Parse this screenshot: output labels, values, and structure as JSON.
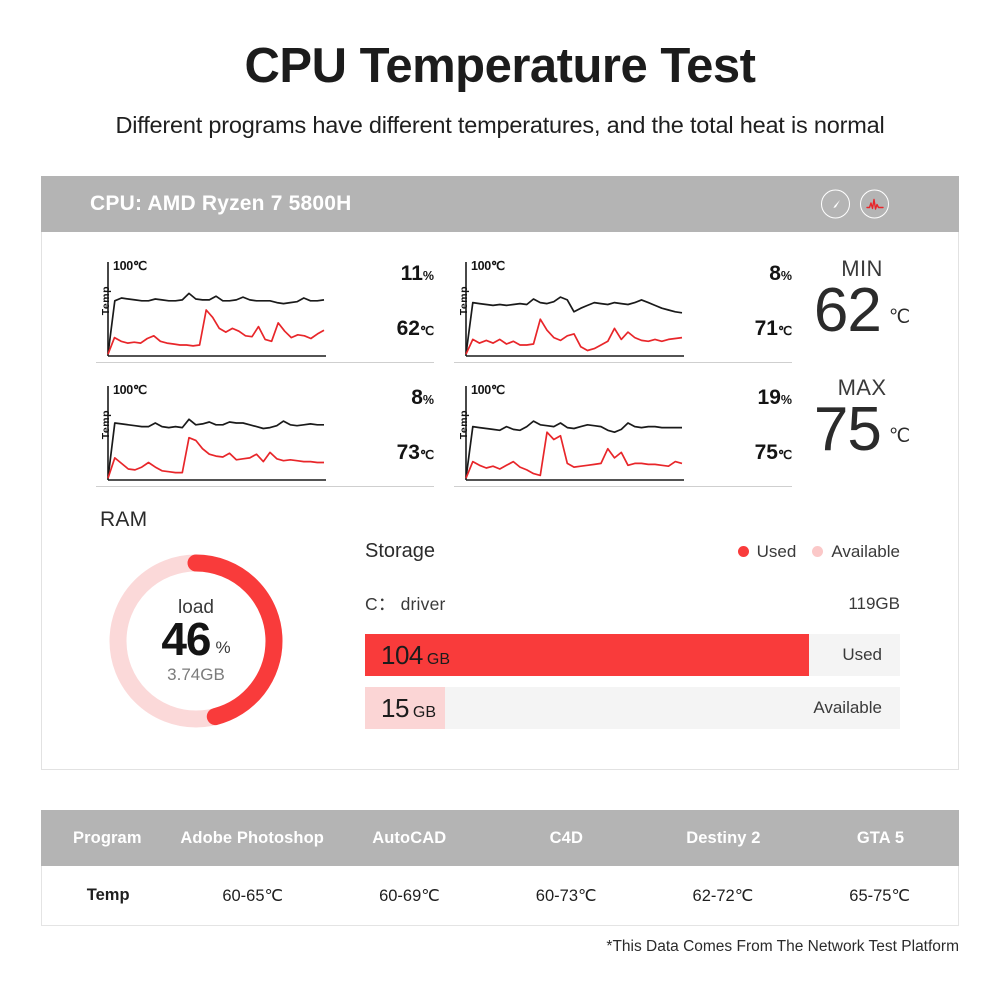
{
  "header": {
    "title": "CPU Temperature Test",
    "subtitle": "Different programs have different temperatures, and the total heat is normal"
  },
  "card": {
    "cpu_label": "CPU: AMD Ryzen 7 5800H",
    "icons": [
      "gauge-icon",
      "pulse-icon"
    ]
  },
  "colors": {
    "accent_red": "#f93b3b",
    "light_red": "#fbd5d5",
    "header_gray": "#b4b4b4",
    "text_dark": "#1c1c1c"
  },
  "chart_data": [
    {
      "type": "line",
      "title": "",
      "xlabel": "",
      "ylabel": "Temp",
      "y_top_tick": "100℃",
      "ylim": [
        0,
        100
      ],
      "grid": false,
      "legend": [],
      "value_labels": {
        "usage": "11",
        "usage_unit": "%",
        "temp": "62",
        "temp_unit": "℃"
      },
      "series": [
        {
          "name": "load-black",
          "color": "#1a1a1a",
          "values": [
            2,
            60,
            63,
            62,
            61,
            60,
            60,
            62,
            61,
            60,
            60,
            61,
            68,
            62,
            61,
            61,
            65,
            60,
            60,
            61,
            64,
            61,
            60,
            60,
            60,
            58,
            57,
            58,
            59,
            63,
            60,
            60,
            61
          ]
        },
        {
          "name": "temp-red",
          "color": "#e8262a",
          "values": [
            2,
            20,
            16,
            14,
            15,
            14,
            19,
            22,
            16,
            14,
            13,
            12,
            12,
            11,
            12,
            50,
            42,
            30,
            26,
            30,
            27,
            22,
            21,
            32,
            18,
            16,
            36,
            27,
            20,
            23,
            22,
            19,
            24,
            28
          ]
        }
      ]
    },
    {
      "type": "line",
      "title": "",
      "xlabel": "",
      "ylabel": "Temp",
      "y_top_tick": "100℃",
      "ylim": [
        0,
        100
      ],
      "grid": false,
      "legend": [],
      "value_labels": {
        "usage": "8",
        "usage_unit": "%",
        "temp": "71",
        "temp_unit": "℃"
      },
      "series": [
        {
          "name": "load-black",
          "color": "#1a1a1a",
          "values": [
            2,
            58,
            57,
            56,
            55,
            56,
            55,
            56,
            57,
            56,
            62,
            58,
            57,
            59,
            64,
            61,
            48,
            52,
            55,
            58,
            57,
            56,
            58,
            57,
            56,
            58,
            61,
            58,
            55,
            52,
            50,
            48,
            47
          ]
        },
        {
          "name": "temp-red",
          "color": "#e8262a",
          "values": [
            2,
            18,
            14,
            17,
            14,
            18,
            13,
            16,
            12,
            12,
            13,
            40,
            28,
            20,
            17,
            22,
            24,
            10,
            6,
            8,
            12,
            16,
            30,
            18,
            26,
            20,
            17,
            16,
            18,
            16,
            18,
            19,
            20
          ]
        }
      ]
    },
    {
      "type": "line",
      "title": "",
      "xlabel": "",
      "ylabel": "Temp",
      "y_top_tick": "100℃",
      "ylim": [
        0,
        100
      ],
      "grid": false,
      "legend": [],
      "value_labels": {
        "usage": "8",
        "usage_unit": "%",
        "temp": "73",
        "temp_unit": "℃"
      },
      "series": [
        {
          "name": "load-black",
          "color": "#1a1a1a",
          "values": [
            2,
            62,
            61,
            60,
            59,
            58,
            58,
            62,
            58,
            57,
            58,
            57,
            66,
            60,
            61,
            63,
            60,
            60,
            63,
            62,
            62,
            60,
            58,
            56,
            57,
            59,
            64,
            60,
            59,
            60,
            61,
            60,
            60
          ]
        },
        {
          "name": "temp-red",
          "color": "#e8262a",
          "values": [
            2,
            24,
            18,
            12,
            11,
            14,
            19,
            14,
            10,
            9,
            8,
            8,
            46,
            43,
            34,
            28,
            26,
            25,
            29,
            22,
            23,
            24,
            28,
            20,
            30,
            23,
            21,
            22,
            21,
            20,
            20,
            19,
            19
          ]
        }
      ]
    },
    {
      "type": "line",
      "title": "",
      "xlabel": "",
      "ylabel": "Temp",
      "y_top_tick": "100℃",
      "ylim": [
        0,
        100
      ],
      "grid": false,
      "legend": [],
      "value_labels": {
        "usage": "19",
        "usage_unit": "%",
        "temp": "75",
        "temp_unit": "℃"
      },
      "series": [
        {
          "name": "load-black",
          "color": "#1a1a1a",
          "values": [
            2,
            58,
            57,
            56,
            55,
            54,
            58,
            55,
            54,
            58,
            64,
            60,
            59,
            58,
            62,
            57,
            56,
            58,
            60,
            59,
            58,
            54,
            52,
            55,
            62,
            58,
            57,
            58,
            58,
            57,
            57,
            57,
            57
          ]
        },
        {
          "name": "temp-red",
          "color": "#e8262a",
          "values": [
            2,
            20,
            16,
            13,
            15,
            12,
            16,
            20,
            14,
            11,
            7,
            5,
            52,
            44,
            48,
            18,
            14,
            15,
            16,
            17,
            18,
            34,
            24,
            30,
            16,
            18,
            18,
            17,
            17,
            16,
            15,
            20,
            18
          ]
        }
      ]
    }
  ],
  "minmax": [
    {
      "label": "MIN",
      "value": "62",
      "unit": "℃"
    },
    {
      "label": "MAX",
      "value": "75",
      "unit": "℃"
    }
  ],
  "ram": {
    "title": "RAM",
    "load_label": "load",
    "percent": "46",
    "percent_unit": "%",
    "amount": "3.74GB",
    "percent_value": 46
  },
  "storage": {
    "title": "Storage",
    "legend": [
      {
        "label": "Used",
        "swatch": "used"
      },
      {
        "label": "Available",
        "swatch": "avail"
      }
    ],
    "drive_name": "C： driver",
    "drive_size": "119GB",
    "bars": [
      {
        "num": "104",
        "unit": "GB",
        "caption": "Used",
        "fill_pct": 83,
        "style": "used"
      },
      {
        "num": "15",
        "unit": "GB",
        "caption": "Available",
        "fill_pct": 15,
        "style": "avail"
      }
    ]
  },
  "table": {
    "headers": [
      "Program",
      "Adobe Photoshop",
      "AutoCAD",
      "C4D",
      "Destiny 2",
      "GTA 5"
    ],
    "row": [
      "Temp",
      "60-65℃",
      "60-69℃",
      "60-73℃",
      "62-72℃",
      "65-75℃"
    ]
  },
  "footnote": "*This Data Comes From The Network Test Platform"
}
